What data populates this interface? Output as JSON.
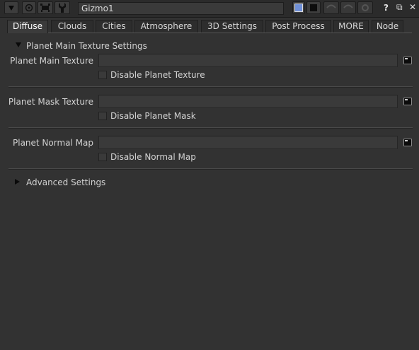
{
  "window": {
    "node_name": "Gizmo1",
    "toolbar_icons": [
      "collapse-arrow-icon",
      "viewer-icon",
      "node-tree-icon",
      "wrench-icon"
    ],
    "color_swatches": [
      "#6f8fd6",
      "#0d0d0d"
    ],
    "right_icons": [
      "undo-icon",
      "redo-icon",
      "revert-icon",
      "help-icon",
      "float-icon",
      "close-icon"
    ],
    "help_glyph": "?",
    "float_glyph": "⧉",
    "close_glyph": "✕"
  },
  "tabs": [
    "Diffuse",
    "Clouds",
    "Cities",
    "Atmosphere",
    "3D Settings",
    "Post Process",
    "MORE",
    "Node"
  ],
  "active_tab": "Diffuse",
  "main_section": {
    "title": "Planet Main Texture Settings",
    "params": [
      {
        "label": "Planet Main Texture",
        "value": "",
        "checkbox_label": "Disable Planet Texture"
      },
      {
        "label": "Planet Mask Texture",
        "value": "",
        "checkbox_label": "Disable Planet Mask"
      },
      {
        "label": "Planet Normal Map",
        "value": "",
        "checkbox_label": "Disable Normal Map"
      }
    ]
  },
  "advanced_section": {
    "title": "Advanced Settings"
  }
}
